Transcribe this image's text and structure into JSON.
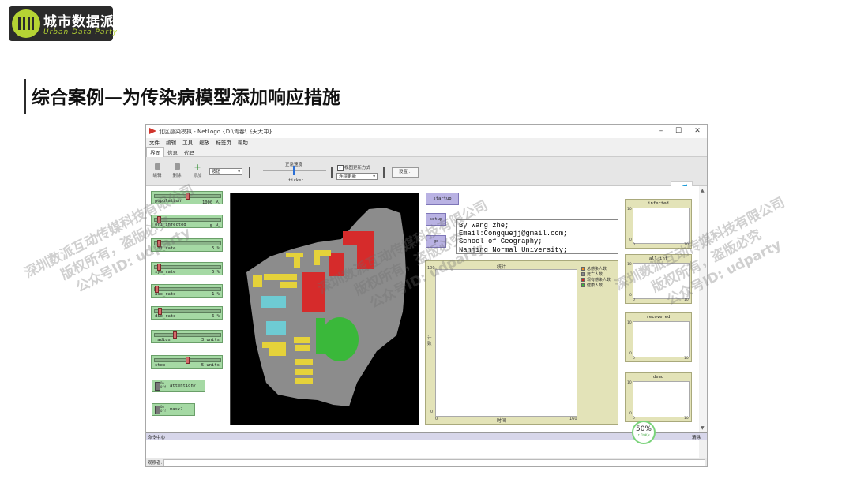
{
  "brand": {
    "name_cn": "城市数据派",
    "name_en": "Urban Data Party",
    "accent": "#b5d334"
  },
  "slide_title": "综合案例—为传染病模型添加响应措施",
  "window": {
    "title": "北区感染模拟 - NetLogo {D:\\青春\\飞天大冲}",
    "controls": [
      "–",
      "☐",
      "✕"
    ],
    "menus": [
      "文件",
      "编辑",
      "工具",
      "缩放",
      "标签页",
      "帮助"
    ],
    "tabs": [
      "界面",
      "信息",
      "代码"
    ],
    "toolbar": {
      "edit_label": "编辑",
      "delete_label": "删除",
      "add_label": "添加",
      "widget_combo": "按钮",
      "speed_label": "正常速度",
      "ticks_label": "ticks:",
      "view_update_label": "视图更新方式",
      "update_mode": "连续更新",
      "settings_label": "设置..."
    }
  },
  "sliders": [
    {
      "name": "population",
      "value": "1000 人",
      "level": 0.5
    },
    {
      "name": "ori_infected",
      "value": "5 人",
      "level": 0.05
    },
    {
      "name": "inf_rate",
      "value": "5 %",
      "level": 0.05
    },
    {
      "name": "sym_rate",
      "value": "5 %",
      "level": 0.05
    },
    {
      "name": "asc_rate",
      "value": "1 %",
      "level": 0.01
    },
    {
      "name": "die_rate",
      "value": "6 %",
      "level": 0.06
    },
    {
      "name": "radius",
      "value": "3 units",
      "level": 0.3
    },
    {
      "name": "step",
      "value": "5 units",
      "level": 0.5
    }
  ],
  "switches": [
    {
      "state": "On\nOff",
      "name": "attention?"
    },
    {
      "state": "On\nOff",
      "name": "mask?"
    }
  ],
  "buttons": {
    "startup": "startup",
    "setup": "setup",
    "go": "go"
  },
  "note_lines": [
    "By Wang zhe;",
    "Email:Congquejj@gmail.com;",
    "School of Geography;",
    "Nanjing Normal University;"
  ],
  "plot": {
    "title": "统计",
    "xlabel": "时间",
    "ylabel": "计数",
    "y_top": "100",
    "y_bottom": "0",
    "x_left": "0",
    "x_right": "160",
    "legend": [
      {
        "label": "总感染人数",
        "color": "#f08a24"
      },
      {
        "label": "死亡人数",
        "color": "#8a8a8a"
      },
      {
        "label": "现有感染人数",
        "color": "#d82020"
      },
      {
        "label": "健康人数",
        "color": "#3ab83a"
      }
    ]
  },
  "chart_data": {
    "type": "line",
    "title": "统计",
    "xlabel": "时间",
    "ylabel": "计数",
    "xlim": [
      0,
      160
    ],
    "ylim": [
      0,
      100
    ],
    "series": [
      {
        "name": "总感染人数",
        "values": []
      },
      {
        "name": "死亡人数",
        "values": []
      },
      {
        "name": "现有感染人数",
        "values": []
      },
      {
        "name": "健康人数",
        "values": []
      }
    ]
  },
  "monitors": [
    {
      "title": "infected",
      "y_top": "10",
      "y_bottom": "0",
      "x_left": "0",
      "x_right": "10"
    },
    {
      "title": "all_inf",
      "y_top": "10",
      "y_bottom": "0",
      "x_left": "0",
      "x_right": "10"
    },
    {
      "title": "recovered",
      "y_top": "10",
      "y_bottom": "0",
      "x_left": "0",
      "x_right": "10"
    },
    {
      "title": "dead",
      "y_top": "10",
      "y_bottom": "0",
      "x_left": "0",
      "x_right": "10"
    }
  ],
  "command_center": {
    "title": "命令中心",
    "clear": "清除",
    "observer": "观察者:"
  },
  "progress_badge": {
    "percent": "50%",
    "speed": "↑ 19K/s"
  },
  "watermarks": [
    {
      "line1": "深圳数派互动传媒科技有限公司",
      "line2": "版权所有，盗版必究",
      "line3": "公众号ID: udparty"
    }
  ]
}
